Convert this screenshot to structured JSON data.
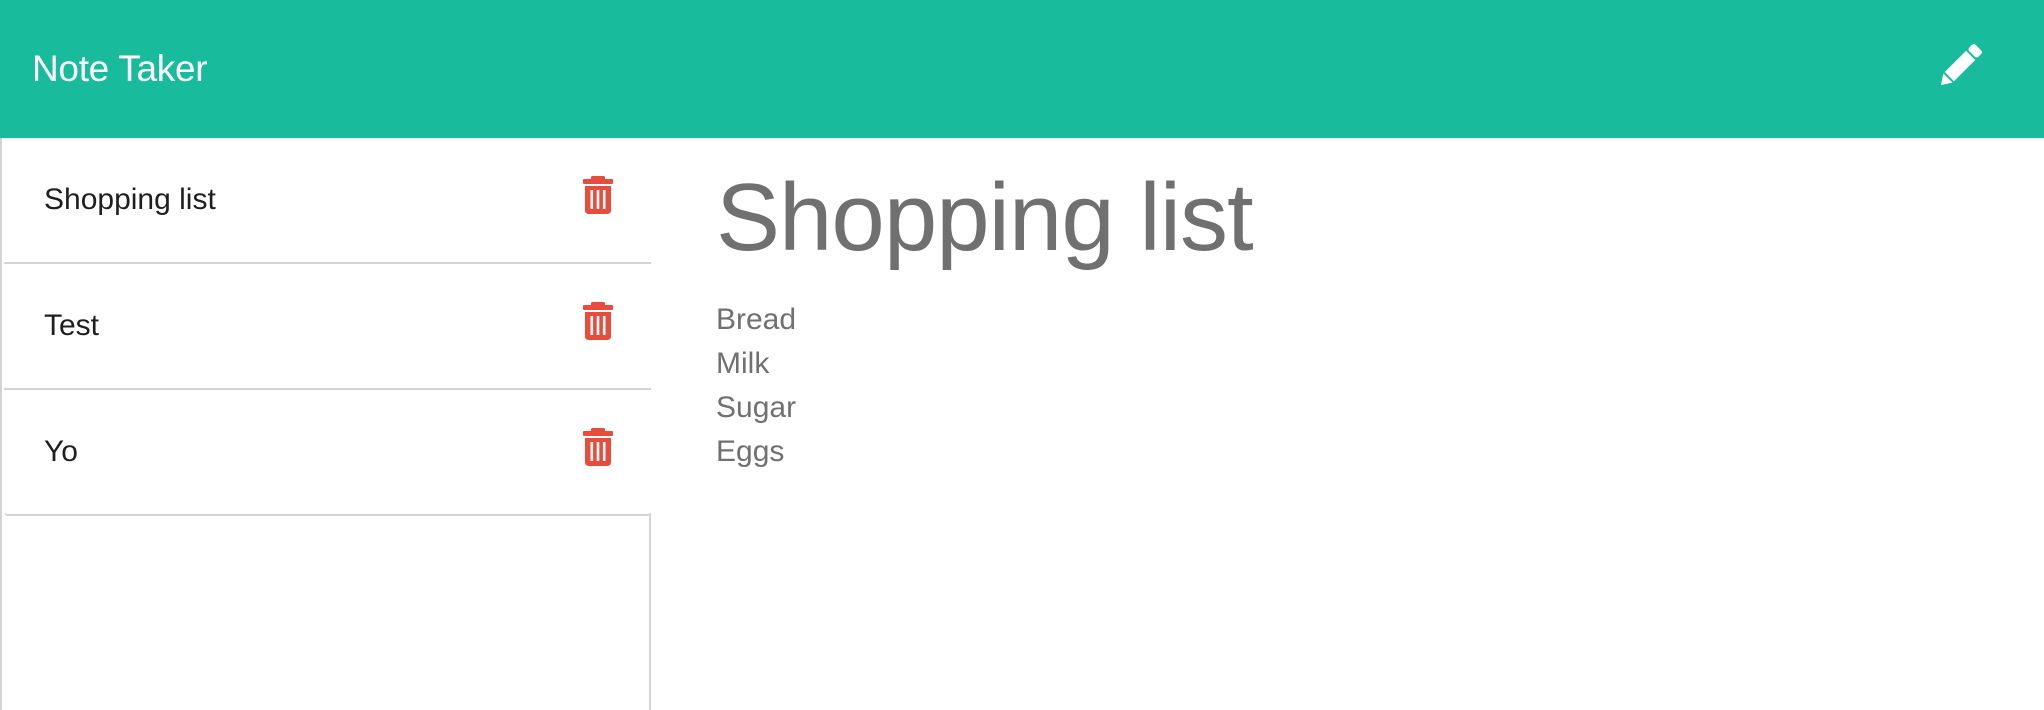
{
  "app": {
    "brand": "Note Taker",
    "colors": {
      "navbar": "#18bc9c",
      "delete_icon": "#e74c3c",
      "note_text": "#707070",
      "list_text": "#1e1e1e"
    }
  },
  "toolbar": {
    "new_note_icon": "pencil-icon"
  },
  "sidebar": {
    "notes": [
      {
        "title": "Shopping list",
        "delete_icon": "trash-icon"
      },
      {
        "title": "Test",
        "delete_icon": "trash-icon"
      },
      {
        "title": "Yo",
        "delete_icon": "trash-icon"
      }
    ]
  },
  "editor": {
    "title": "Shopping list",
    "body": "Bread\nMilk\nSugar\nEggs"
  }
}
